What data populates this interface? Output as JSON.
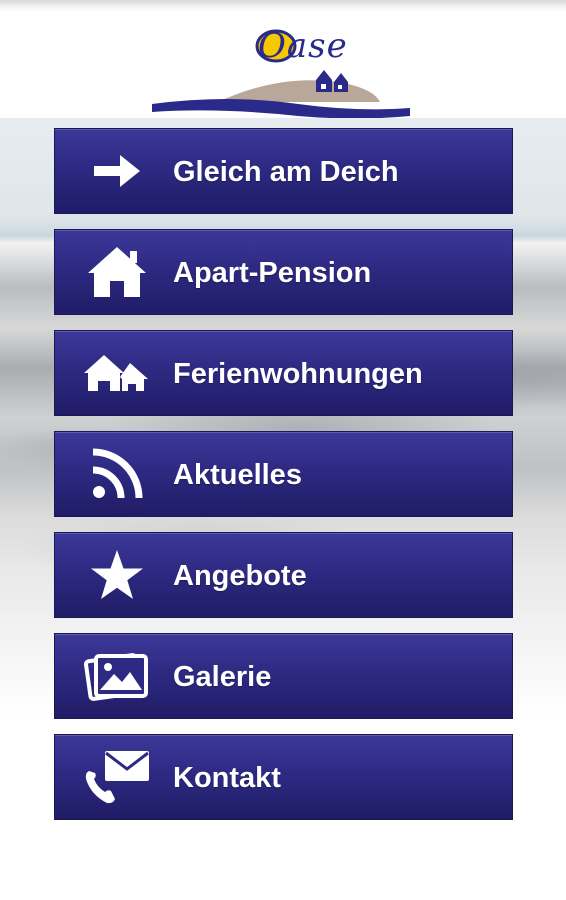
{
  "logo": {
    "text": "Oase",
    "icon": "beach-houses-logo"
  },
  "menu": {
    "items": [
      {
        "label": "Gleich am Deich",
        "icon": "arrow-right-icon"
      },
      {
        "label": "Apart-Pension",
        "icon": "house-icon"
      },
      {
        "label": "Ferienwohnungen",
        "icon": "houses-icon"
      },
      {
        "label": "Aktuelles",
        "icon": "rss-icon"
      },
      {
        "label": "Angebote",
        "icon": "star-icon"
      },
      {
        "label": "Galerie",
        "icon": "gallery-icon"
      },
      {
        "label": "Kontakt",
        "icon": "phone-mail-icon"
      }
    ]
  },
  "colors": {
    "button": "#2e2a83",
    "logo_text": "#2a2a8a",
    "logo_sun": "#f5c800"
  }
}
